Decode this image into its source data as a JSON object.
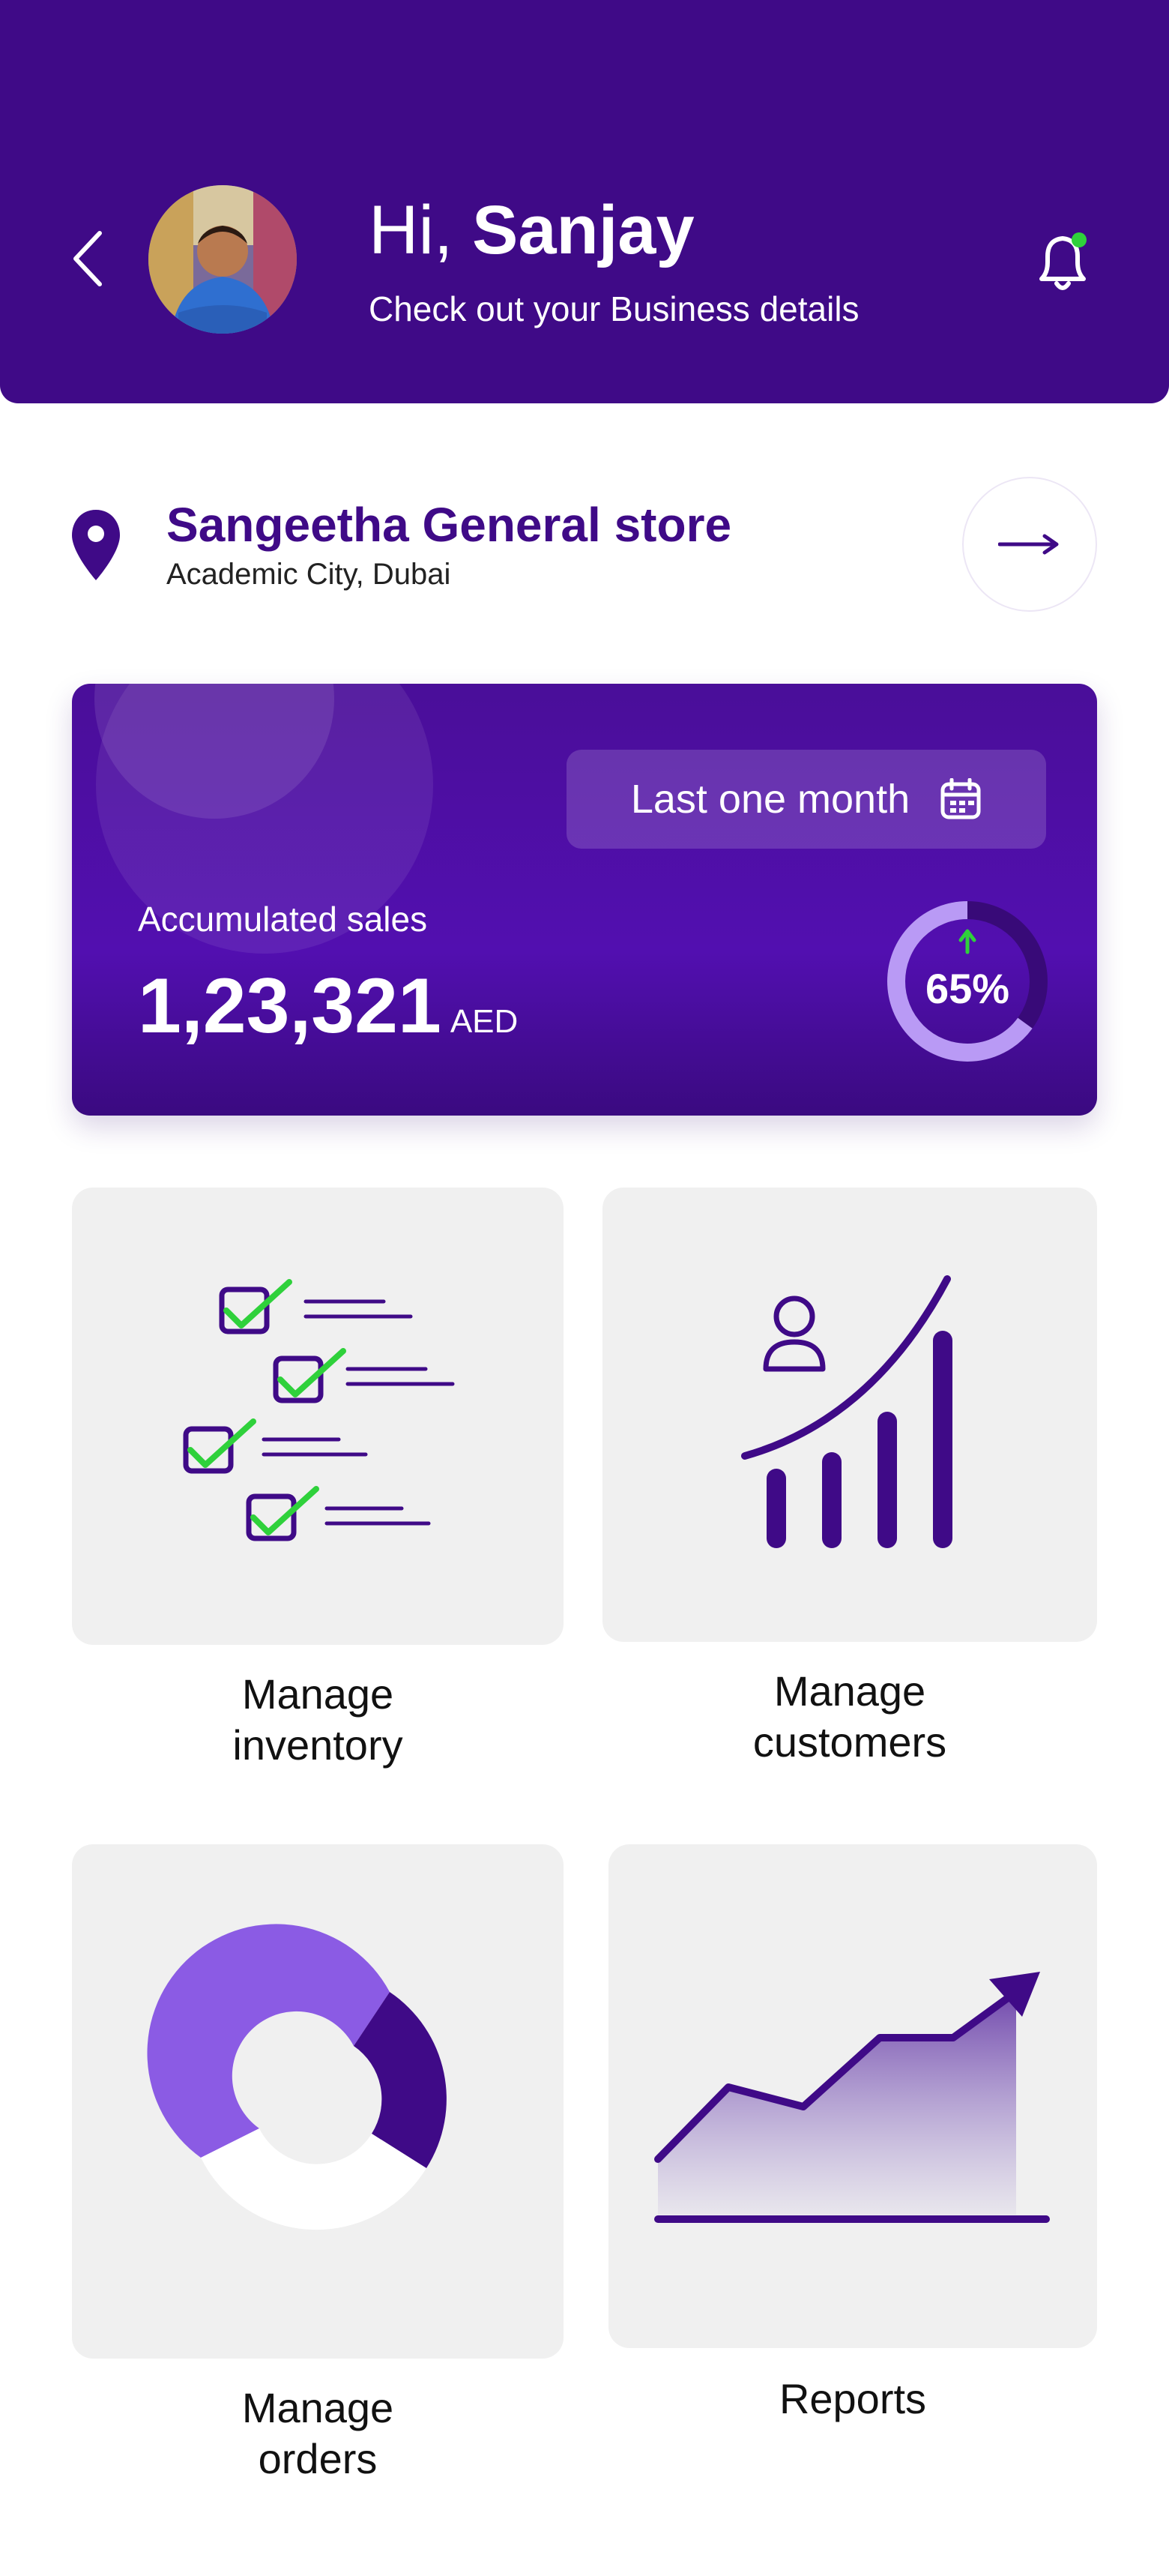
{
  "header": {
    "greeting_prefix": "Hi,",
    "user_name": "Sanjay",
    "subtitle": "Check out your Business details",
    "has_notification": true
  },
  "store": {
    "name": "Sangeetha General store",
    "location": "Academic City, Dubai"
  },
  "sales": {
    "period_label": "Last one month",
    "label": "Accumulated sales",
    "value": "1,23,321",
    "currency": "AED",
    "growth_label": "65%",
    "growth_fraction": 0.65
  },
  "tiles": [
    {
      "label": "Manage inventory",
      "icon": "checklist-icon"
    },
    {
      "label": "Manage customers",
      "icon": "customer-growth-icon"
    },
    {
      "label": "Manage orders",
      "icon": "donut-chart-icon"
    },
    {
      "label": "Reports",
      "icon": "trend-chart-icon"
    }
  ],
  "colors": {
    "brand": "#3f0a87",
    "accent": "#8b5be4",
    "success": "#2fd13b",
    "tile_bg": "#f0f0f0"
  }
}
